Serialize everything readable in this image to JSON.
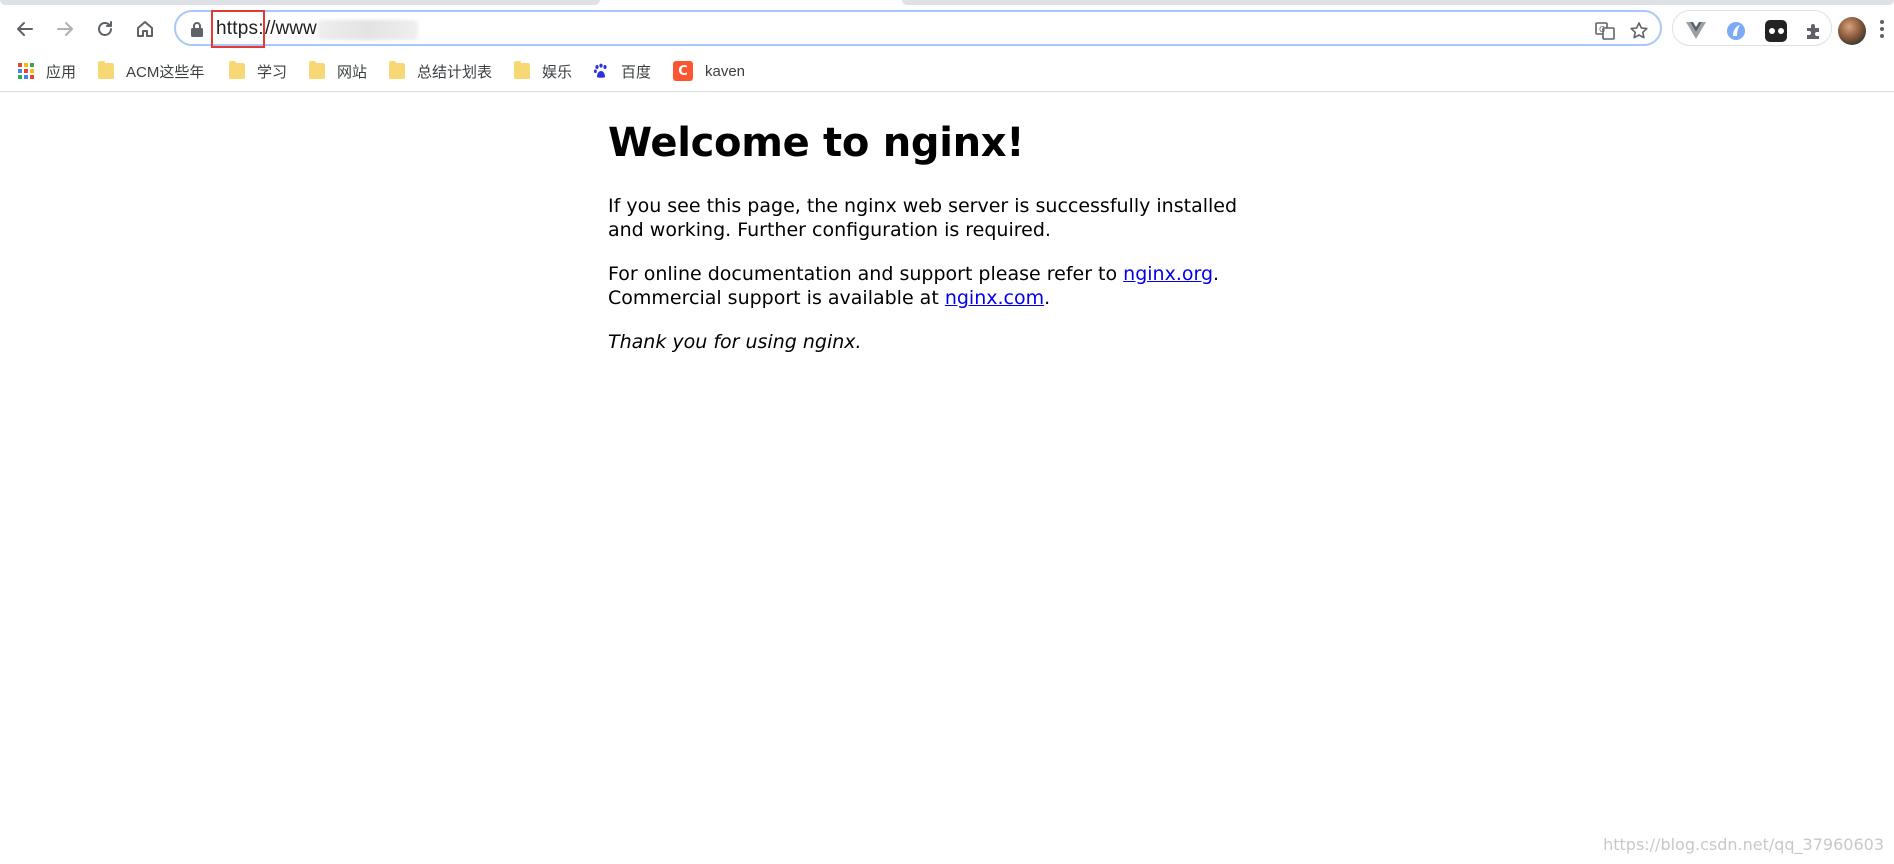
{
  "browser": {
    "address_bar": {
      "scheme": "https:",
      "rest": "//www"
    },
    "bookmarks": [
      {
        "label": "应用",
        "icon": "apps-grid-icon"
      },
      {
        "label": "ACM这些年",
        "icon": "folder-icon"
      },
      {
        "label": "学习",
        "icon": "folder-icon"
      },
      {
        "label": "网站",
        "icon": "folder-icon"
      },
      {
        "label": "总结计划表",
        "icon": "folder-icon"
      },
      {
        "label": "娱乐",
        "icon": "folder-icon"
      },
      {
        "label": "百度",
        "icon": "baidu-paw-icon"
      },
      {
        "label": "kaven",
        "icon": "csdn-c-icon"
      }
    ]
  },
  "page": {
    "heading": "Welcome to nginx!",
    "intro": "If you see this page, the nginx web server is successfully installed and working. Further configuration is required.",
    "docs_prefix": "For online documentation and support please refer to ",
    "docs_link": "nginx.org",
    "docs_suffix": ".",
    "commercial_prefix": "Commercial support is available at ",
    "commercial_link": "nginx.com",
    "commercial_suffix": ".",
    "thanks": "Thank you for using nginx."
  },
  "watermark": "https://blog.csdn.net/qq_37960603",
  "colors": {
    "link": "#0000ee",
    "highlight_box": "#e53935",
    "omnibox_border": "#a8c7fa"
  }
}
